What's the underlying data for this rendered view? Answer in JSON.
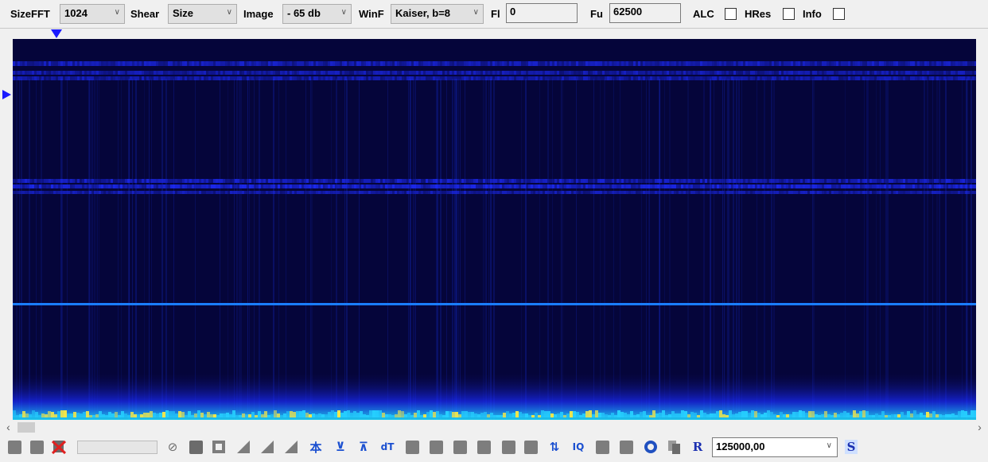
{
  "toolbar": {
    "sizefft_label": "SizeFFT",
    "sizefft_value": "1024",
    "shear_label": "Shear",
    "shear_value": "Size",
    "image_label": "Image",
    "image_value": "- 65 db",
    "winf_label": "WinF",
    "winf_value": "Kaiser, b=8",
    "fl_label": "Fl",
    "fl_value": "0",
    "fu_label": "Fu",
    "fu_value": "62500",
    "alc_label": "ALC",
    "alc_checked": false,
    "hres_label": "HRes",
    "hres_checked": false,
    "info_label": "Info",
    "info_checked": false
  },
  "spectrogram": {
    "background_color": "#05053a",
    "band_color": "#1e2cff",
    "line_color": "#1a7dff",
    "hot_color": "#f2e64a"
  },
  "scrollbar": {
    "left_arrow": "‹",
    "right_arrow": "›"
  },
  "bottombar": {
    "rate_value": "125000,00",
    "button_glyphs": {
      "stretch_v": "本",
      "compress_v": "⊻",
      "fit_v": "⊼",
      "dt": "dT",
      "swap": "⇅",
      "iq": "IQ",
      "r": "R",
      "s": "S",
      "no": "⊘"
    },
    "icons": [
      "blank-icon",
      "blank-icon",
      "delete-icon",
      "progress-bar",
      "no-entry-icon",
      "window-icon",
      "frame-icon",
      "triangle-icon",
      "triangle-icon",
      "triangle-icon",
      "stretch-icon",
      "compress-icon",
      "fit-icon",
      "dt-icon",
      "block-icon",
      "block-icon",
      "block-icon",
      "block-icon",
      "block-icon",
      "block-icon",
      "swap-icon",
      "iq-icon",
      "block-icon",
      "block-icon",
      "settings-icon",
      "copy-icon",
      "r-icon",
      "s-icon"
    ]
  }
}
